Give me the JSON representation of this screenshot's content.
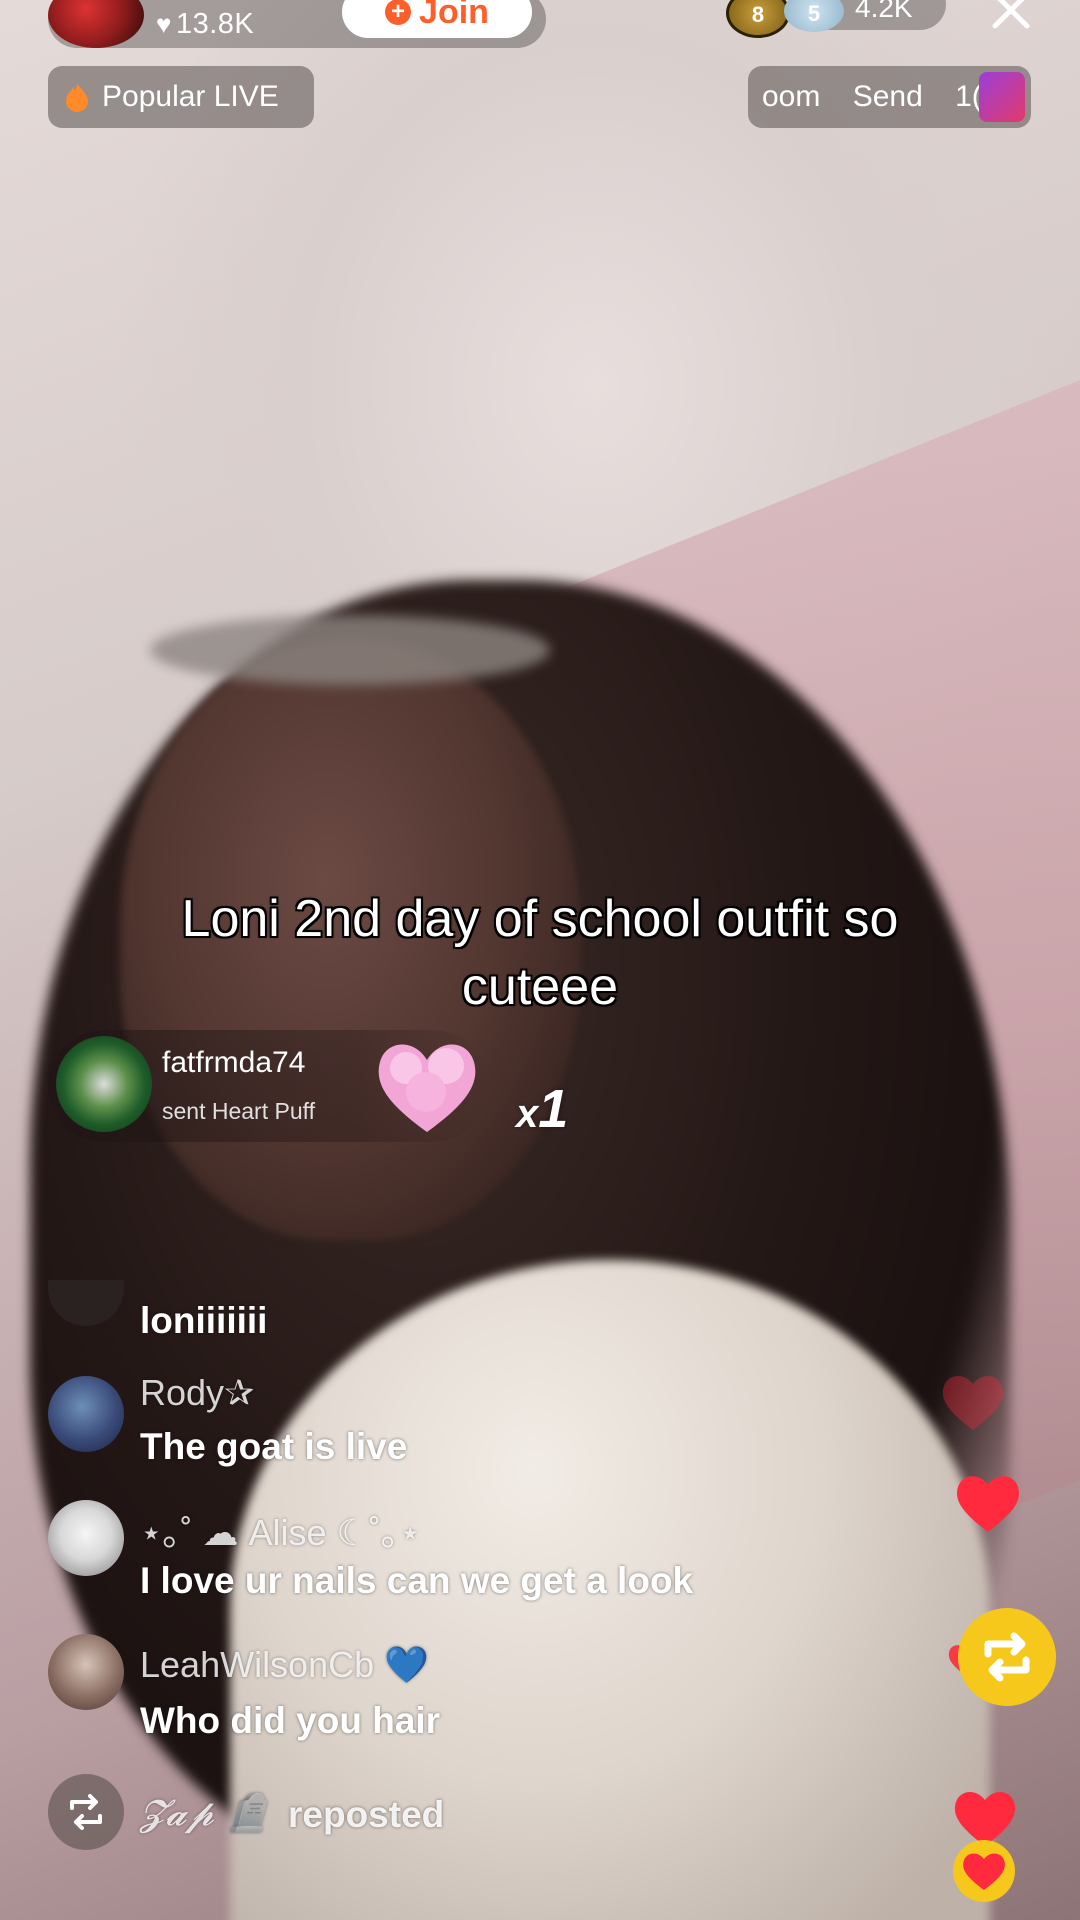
{
  "header": {
    "likes": "13.8K",
    "join_label": "Join",
    "viewer_count": "4.2K",
    "badge_top_rank": "8",
    "badge_second_rank": "5"
  },
  "popular_live": {
    "label": "Popular LIVE"
  },
  "promo": {
    "text": "oom Send 1("
  },
  "caption": "Loni 2nd day of school outfit so cuteee",
  "gift": {
    "user": "fatfrmda74",
    "text": "sent Heart Puff",
    "count": "1",
    "count_prefix": "x"
  },
  "comments": [
    {
      "name": "",
      "text": "loniiiiiii"
    },
    {
      "name": "Rody✰",
      "text": "The goat is live"
    },
    {
      "name": "⋆｡˚ ☁︎ Alise ☾˚｡⋆",
      "text": "I love ur nails can we get a look"
    },
    {
      "name": "LeahWilsonCb 💙",
      "text": "Who did you hair"
    }
  ],
  "repost": {
    "user": "𝓩𝓪𝓹 🪦",
    "text": "reposted"
  },
  "colors": {
    "accent": "#fe5e2a",
    "heart": "#ff2a3d",
    "repost_fab": "#f7c81c"
  }
}
